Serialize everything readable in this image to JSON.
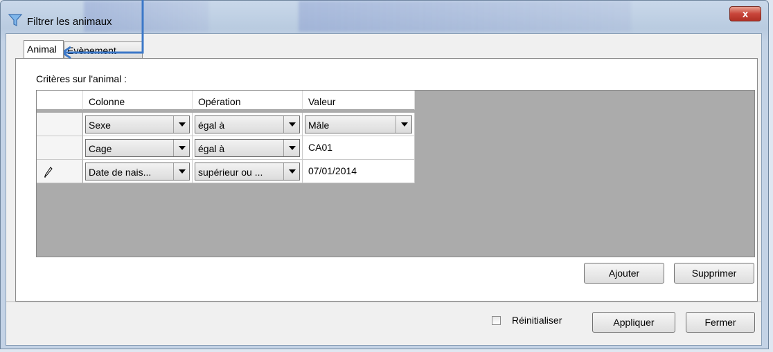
{
  "window": {
    "title": "Filtrer les animaux",
    "close_label": "x"
  },
  "tabs": [
    {
      "label": "Animal",
      "active": true
    },
    {
      "label": "Evènement",
      "active": false
    }
  ],
  "criteria_label": "Critères sur l'animal :",
  "grid": {
    "columns": [
      "Colonne",
      "Opération",
      "Valeur"
    ],
    "rows": [
      {
        "column": "Sexe",
        "operation": "égal à",
        "value": "Mâle",
        "value_is_dropdown": true,
        "editing": false
      },
      {
        "column": "Cage",
        "operation": "égal à",
        "value": "CA01",
        "value_is_dropdown": false,
        "editing": false
      },
      {
        "column": "Date de nais...",
        "operation": "supérieur ou ...",
        "value": "07/01/2014",
        "value_is_dropdown": false,
        "editing": true
      }
    ]
  },
  "buttons": {
    "add": "Ajouter",
    "delete": "Supprimer",
    "apply": "Appliquer",
    "close": "Fermer"
  },
  "reset": {
    "label": "Réinitialiser",
    "checked": false
  },
  "colors": {
    "annotation": "#3c78c8",
    "grid_empty": "#ababab"
  },
  "icons": {
    "title": "funnel-icon",
    "row_edit": "pencil-icon",
    "annotation": "arrow-icon"
  }
}
